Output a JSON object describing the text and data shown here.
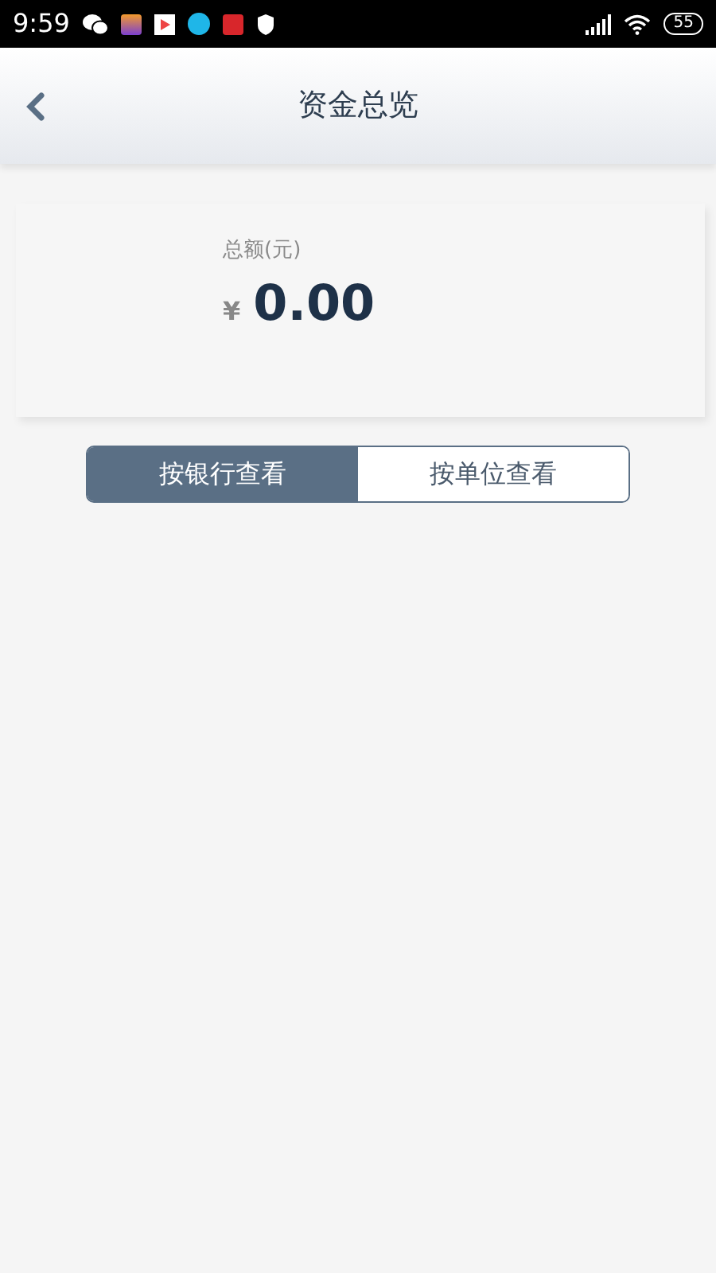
{
  "status_bar": {
    "time": "9:59",
    "battery": "55"
  },
  "header": {
    "title": "资金总览"
  },
  "summary": {
    "label": "总额(元)",
    "currency": "¥",
    "amount": "0.00"
  },
  "tabs": [
    {
      "label": "按银行查看",
      "selected": true
    },
    {
      "label": "按单位查看",
      "selected": false
    }
  ]
}
